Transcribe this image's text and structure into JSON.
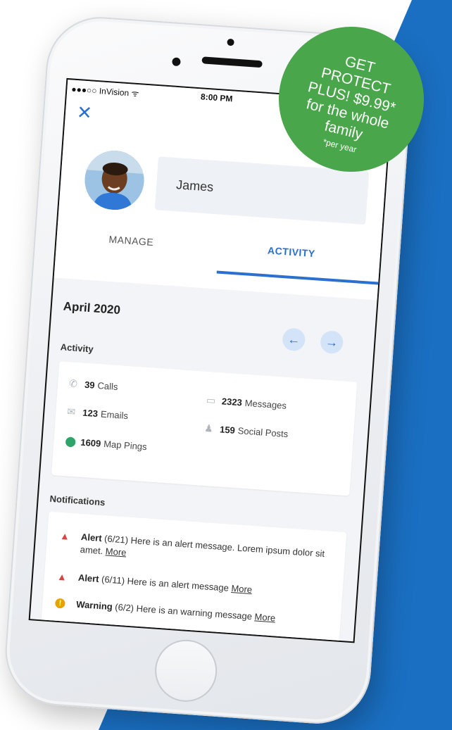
{
  "status_bar": {
    "carrier": "●●●○○ InVision ᯤ",
    "time": "8:00 PM"
  },
  "profile": {
    "name": "James"
  },
  "tabs": [
    {
      "label": "MANAGE"
    },
    {
      "label": "ACTIVITY"
    }
  ],
  "period": {
    "month": "April 2020",
    "prev_icon": "←",
    "next_icon": "→"
  },
  "activity": {
    "label": "Activity",
    "stats": [
      {
        "icon": "phone-icon",
        "value": "39",
        "label": "Calls"
      },
      {
        "icon": "message-icon",
        "value": "2323",
        "label": "Messages"
      },
      {
        "icon": "email-icon",
        "value": "123",
        "label": "Emails"
      },
      {
        "icon": "snapchat-icon",
        "value": "159",
        "label": "Social Posts"
      },
      {
        "icon": "map-pin-icon",
        "value": "1609",
        "label": "Map Pings"
      }
    ]
  },
  "notifications": {
    "label": "Notifications",
    "items": [
      {
        "type": "Alert",
        "date": "(6/21)",
        "message": "Here is an alert message. Lorem ipsum dolor sit amet.",
        "more": "More"
      },
      {
        "type": "Alert",
        "date": "(6/11)",
        "message": "Here is an alert message",
        "more": "More"
      },
      {
        "type": "Warning",
        "date": "(6/2)",
        "message": "Here is an warning message",
        "more": "More"
      }
    ]
  },
  "promo": {
    "line1": "GET",
    "line2": "PROTECT",
    "line3": "PLUS! $9.99*",
    "line4": "for the whole",
    "line5": "family",
    "footnote": "*per year"
  },
  "colors": {
    "accent": "#2b6fcf",
    "brand_blue": "#1a6fc2",
    "promo_green": "#4aa64a",
    "alert_red": "#d64545",
    "warning_amber": "#e7a200",
    "pin_green": "#2fa46a"
  }
}
